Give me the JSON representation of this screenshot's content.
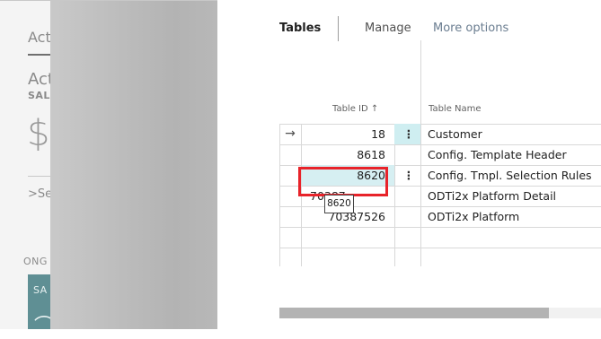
{
  "background": {
    "actions_tab": "Acti",
    "activities_title": "Act",
    "sales_label": "SALI",
    "currency_symbol": "$",
    "see_more": ">Se",
    "ongoing_label": "ONG",
    "tile_label": "SA"
  },
  "action_bar": {
    "tables": "Tables",
    "manage": "Manage",
    "more_options": "More options"
  },
  "table": {
    "columns": {
      "table_id": "Table ID ↑",
      "table_name": "Table Name"
    },
    "rows": [
      {
        "arrow": "→",
        "id": "18",
        "menu": "⋮",
        "name": "Customer"
      },
      {
        "arrow": "",
        "id": "8618",
        "menu": "",
        "name": "Config. Template Header"
      },
      {
        "arrow": "",
        "id": "8620",
        "menu": "⋮",
        "name": "Config. Tmpl. Selection Rules"
      },
      {
        "arrow": "",
        "id": "70387",
        "menu": "",
        "name": "ODTi2x Platform Detail"
      },
      {
        "arrow": "",
        "id": "70387526",
        "menu": "",
        "name": "ODTi2x Platform"
      }
    ]
  },
  "tooltip": "8620",
  "colors": {
    "highlight": "#d6eff2",
    "focus_border": "#e8232a"
  }
}
